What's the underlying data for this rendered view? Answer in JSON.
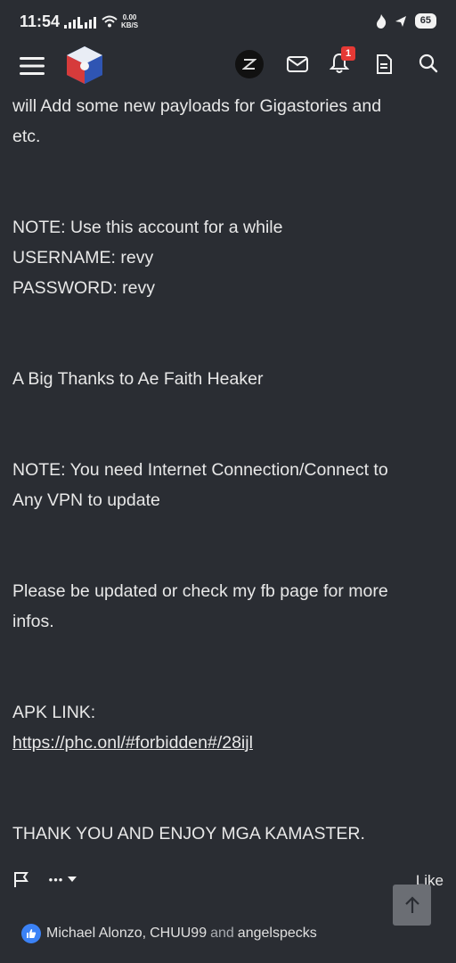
{
  "status_bar": {
    "time": "11:54",
    "net_speed_value": "0.00",
    "net_speed_unit": "KB/S",
    "battery": "65"
  },
  "app_bar": {
    "notification_count": "1"
  },
  "post": {
    "line_1": "will Add some new payloads for Gigastories and",
    "line_2": "etc.",
    "note_1": "NOTE: Use this account for a while",
    "username": "USERNAME: revy",
    "password": "PASSWORD: revy",
    "thanks": "A Big Thanks to Ae Faith Heaker",
    "note_2_line_1": "NOTE: You need Internet Connection/Connect to",
    "note_2_line_2": "Any VPN to update",
    "update_line_1": "Please be updated or check my fb page for more",
    "update_line_2": "infos.",
    "apk_label": "APK LINK:",
    "apk_link": "https://phc.onl/#forbidden#/28ijl",
    "closing": "THANK YOU AND ENJOY MGA KAMASTER."
  },
  "actions": {
    "like_label": "Like",
    "more_label": "•••"
  },
  "reactions": {
    "user_1": "Michael Alonzo",
    "separator": ",",
    "user_2": "CHUU99",
    "and_label": "and",
    "user_3": "angelspecks"
  },
  "colors": {
    "background": "#2a2d33",
    "text": "#e8e8e8",
    "badge": "#e53935",
    "like": "#3b82f6"
  }
}
